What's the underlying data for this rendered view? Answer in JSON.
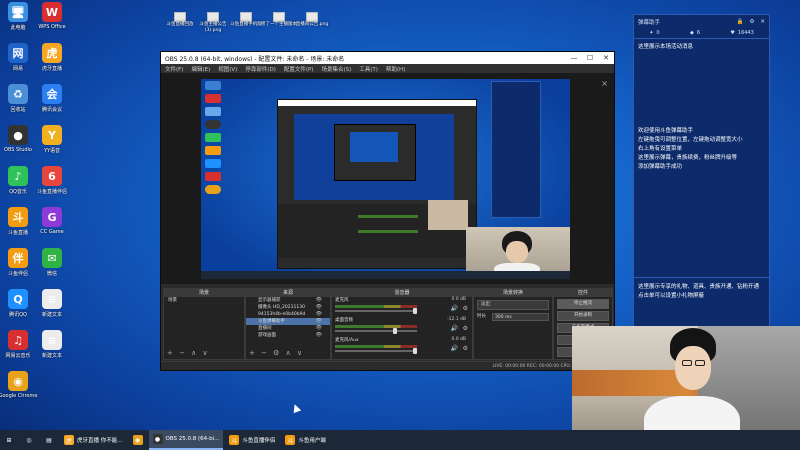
{
  "desktop": {
    "icons": [
      {
        "label": "此电脑",
        "sym": "🖥",
        "color": "#3b8fe0"
      },
      {
        "label": "WPS Office",
        "sym": "W",
        "color": "#d83030"
      },
      {
        "label": "网易",
        "sym": "网",
        "color": "#1e64c8"
      },
      {
        "label": "虎牙直播",
        "sym": "虎",
        "color": "#f5a623"
      },
      {
        "label": "回收站",
        "sym": "♻",
        "color": "#4a8fd8"
      },
      {
        "label": "腾讯会议",
        "sym": "会",
        "color": "#2b7ff0"
      },
      {
        "label": "OBS Studio",
        "sym": "●",
        "color": "#333"
      },
      {
        "label": "YY语音",
        "sym": "Y",
        "color": "#f0b020"
      },
      {
        "label": "QQ音乐",
        "sym": "♪",
        "color": "#2fc25b"
      },
      {
        "label": "斗鱼直播伴侣",
        "sym": "6",
        "color": "#e8463c"
      },
      {
        "label": "斗鱼直播",
        "sym": "斗",
        "color": "#f39c12"
      },
      {
        "label": "CC Game",
        "sym": "G",
        "color": "#8e3ad8"
      },
      {
        "label": "斗鱼伴侣",
        "sym": "伴",
        "color": "#f39c12"
      },
      {
        "label": "微信",
        "sym": "✉",
        "color": "#2fb344"
      },
      {
        "label": "腾讯QQ",
        "sym": "Q",
        "color": "#1e90ff"
      },
      {
        "label": "新建文本",
        "sym": "≡",
        "color": "#ececec"
      },
      {
        "label": "网易云音乐",
        "sym": "♫",
        "color": "#d83030"
      },
      {
        "label": "新建文本",
        "sym": "≡",
        "color": "#ececec"
      },
      {
        "label": "Google Chrome",
        "sym": "◉",
        "color": "#e8a21a"
      }
    ],
    "top_files": [
      "斗鱼直播回放",
      "斗鱼主播公告(3).png",
      "斗鱼直播手机版",
      "修了一个主播版本",
      "直播间公告.png"
    ]
  },
  "obs": {
    "title": "OBS 25.0.8 (64-bit, windows) - 配置文件: 未命名 - 场景: 未命名",
    "menu": [
      "文件(F)",
      "编辑(E)",
      "视图(V)",
      "停靠部件(D)",
      "配置文件(P)",
      "场景集合(S)",
      "工具(T)",
      "帮助(H)"
    ],
    "docks": {
      "scenes": {
        "title": "场景",
        "items": [
          "场景"
        ]
      },
      "sources": {
        "title": "来源",
        "items": [
          "显示器捕获",
          "摄像头 HD_20211130",
          "94153h4b-e0b40b9d",
          "斗鱼弹幕助手",
          "直播间",
          "游戏画面"
        ],
        "selected": 3
      },
      "mixer": {
        "title": "混音器",
        "rows": [
          {
            "name": "麦克风",
            "db": "0.0 dB"
          },
          {
            "name": "桌面音频",
            "db": "-12.1 dB"
          },
          {
            "name": "麦克风/Aux",
            "db": "0.0 dB"
          }
        ]
      },
      "transitions": {
        "title": "场景转换",
        "type": "淡出",
        "duration_label": "时长",
        "duration": "300 ms"
      },
      "controls": {
        "title": "控件",
        "buttons": [
          "停止推流",
          "开始录制",
          "工作室模式",
          "设置",
          "退出"
        ]
      }
    },
    "status": "LIVE: 00:00:00   REC: 00:00:00   CPU: 5.0%, 30.00 fps"
  },
  "chat": {
    "title": "弹幕助手",
    "stats": [
      "0",
      "6",
      "16443"
    ],
    "messages_top": [
      "这里展示本场活动消息"
    ],
    "messages_mid": [
      "欢迎使用斗鱼弹幕助手",
      "左键拖曳可调整位置，左键拖动调整宽大小",
      "右上角有设置菜单",
      "这里展示弹幕，贵族续费，粉丝牌升级等",
      "添加弹幕助手成功"
    ],
    "messages_bottom": [
      "这里展示专享的礼物、道具、贵族开通、钻粉开通",
      "点击单可以设置小礼物屏蔽"
    ]
  },
  "taskbar": {
    "items": [
      {
        "label": "",
        "sym": "⊞",
        "color": "#1c2838",
        "active": false
      },
      {
        "label": "",
        "sym": "◎",
        "color": "#1c2838",
        "active": false
      },
      {
        "label": "",
        "sym": "▤",
        "color": "#1c2838",
        "active": false
      },
      {
        "label": "虎牙直播 你不能...",
        "sym": "虎",
        "color": "#f5a623",
        "active": false
      },
      {
        "label": "",
        "sym": "◉",
        "color": "#e8a21a",
        "active": false
      },
      {
        "label": "OBS 25.0.8 (64-bi...",
        "sym": "●",
        "color": "#333",
        "active": true
      },
      {
        "label": "斗鱼直播伴侣",
        "sym": "斗",
        "color": "#f39c12",
        "active": false
      },
      {
        "label": "斗鱼用户端",
        "sym": "斗",
        "color": "#f39c12",
        "active": false
      }
    ]
  }
}
